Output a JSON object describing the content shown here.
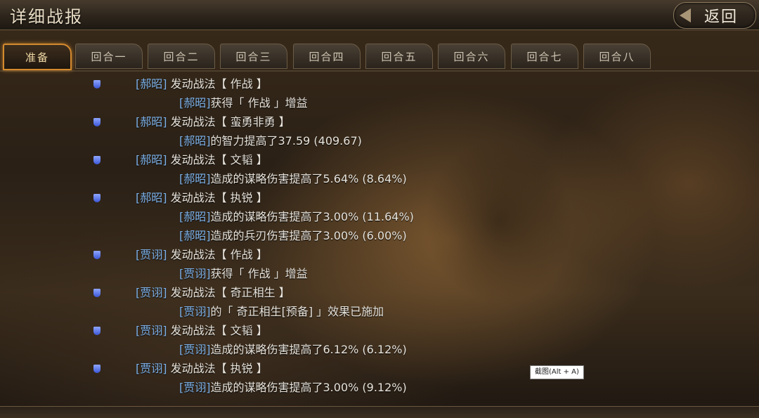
{
  "header": {
    "title": "详细战报",
    "back_label": "返回"
  },
  "tabs": [
    {
      "label": "准备",
      "active": true
    },
    {
      "label": "回合一",
      "active": false
    },
    {
      "label": "回合二",
      "active": false
    },
    {
      "label": "回合三",
      "active": false
    },
    {
      "label": "回合四",
      "active": false
    },
    {
      "label": "回合五",
      "active": false
    },
    {
      "label": "回合六",
      "active": false
    },
    {
      "label": "回合七",
      "active": false
    },
    {
      "label": "回合八",
      "active": false
    }
  ],
  "log": [
    {
      "type": "tactic",
      "name": "[郝昭]",
      "text": " 发动战法【 作战 】"
    },
    {
      "type": "effect",
      "name": "[郝昭]",
      "text": "获得「 作战 」增益"
    },
    {
      "type": "tactic",
      "name": "[郝昭]",
      "text": " 发动战法【 蛮勇非勇 】"
    },
    {
      "type": "effect",
      "name": "[郝昭]",
      "text": "的智力提高了37.59 (409.67)"
    },
    {
      "type": "tactic",
      "name": "[郝昭]",
      "text": " 发动战法【 文韬 】"
    },
    {
      "type": "effect",
      "name": "[郝昭]",
      "text": "造成的谋略伤害提高了5.64% (8.64%)"
    },
    {
      "type": "tactic",
      "name": "[郝昭]",
      "text": " 发动战法【 执锐 】"
    },
    {
      "type": "effect",
      "name": "[郝昭]",
      "text": "造成的谋略伤害提高了3.00% (11.64%)"
    },
    {
      "type": "effect",
      "name": "[郝昭]",
      "text": "造成的兵刃伤害提高了3.00% (6.00%)"
    },
    {
      "type": "tactic",
      "name": "[贾诩]",
      "text": " 发动战法【 作战 】"
    },
    {
      "type": "effect",
      "name": "[贾诩]",
      "text": "获得「 作战 」增益"
    },
    {
      "type": "tactic",
      "name": "[贾诩]",
      "text": " 发动战法【 奇正相生 】"
    },
    {
      "type": "effect",
      "name": "[贾诩]",
      "text": "的「 奇正相生[预备] 」效果已施加"
    },
    {
      "type": "tactic",
      "name": "[贾诩]",
      "text": " 发动战法【 文韬 】"
    },
    {
      "type": "effect",
      "name": "[贾诩]",
      "text": "造成的谋略伤害提高了6.12% (6.12%)"
    },
    {
      "type": "tactic",
      "name": "[贾诩]",
      "text": " 发动战法【 执锐 】"
    },
    {
      "type": "effect",
      "name": "[贾诩]",
      "text": "造成的谋略伤害提高了3.00% (9.12%)"
    }
  ],
  "tooltip": "截图(Alt + A)"
}
